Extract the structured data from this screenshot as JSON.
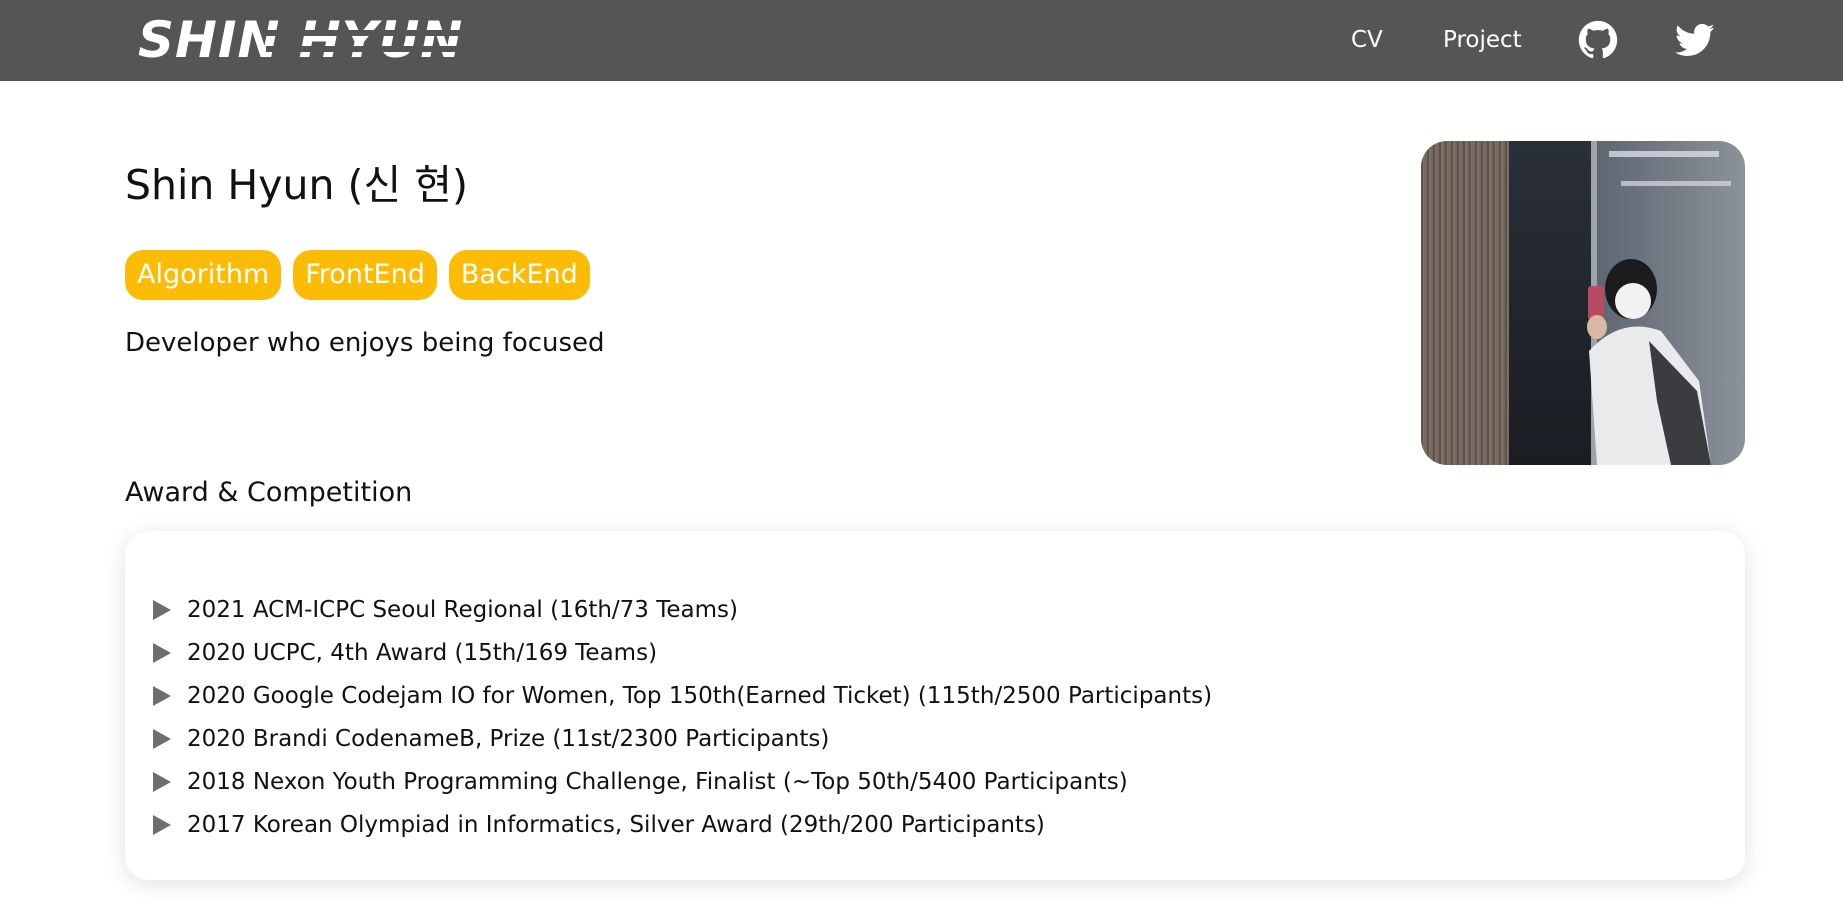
{
  "header": {
    "logo_text": "SHIN HYUN",
    "nav_links": [
      "CV",
      "Project"
    ],
    "icons": [
      "github-icon",
      "twitter-icon"
    ],
    "background_color": "#555555"
  },
  "profile": {
    "name": "Shin Hyun (신 현)",
    "tags": [
      "Algorithm",
      "FrontEnd",
      "BackEnd"
    ],
    "tag_color": "#fcbc05",
    "tagline": "Developer who enjoys being focused"
  },
  "awards": {
    "title": "Award & Competition",
    "items": [
      "2021 ACM-ICPC Seoul Regional (16th/73 Teams)",
      "2020 UCPC, 4th Award (15th/169 Teams)",
      "2020 Google Codejam IO for Women, Top 150th(Earned Ticket) (115th/2500 Participants)",
      "2020 Brandi CodenameB, Prize (11st/2300 Participants)",
      "2018 Nexon Youth Programming Challenge, Finalist (~Top 50th/5400 Participants)",
      "2017 Korean Olympiad in Informatics, Silver Award (29th/200 Participants)"
    ]
  }
}
